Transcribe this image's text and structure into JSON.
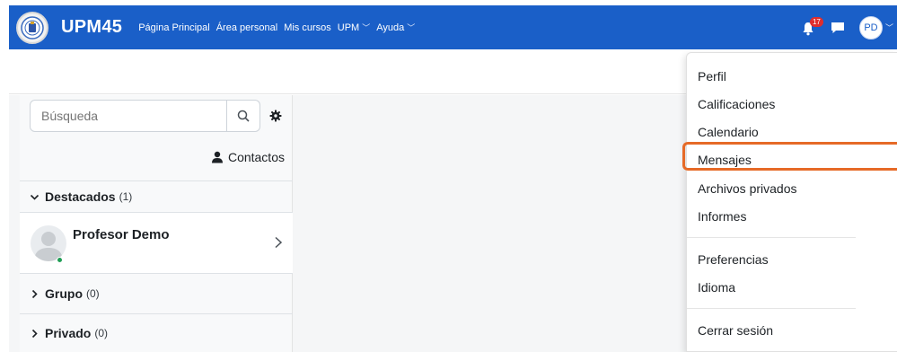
{
  "navbar": {
    "brand": "UPM45",
    "links": [
      {
        "label": "Página Principal",
        "has_dropdown": false
      },
      {
        "label": "Área personal",
        "has_dropdown": false
      },
      {
        "label": "Mis cursos",
        "has_dropdown": false
      },
      {
        "label": "UPM",
        "has_dropdown": true
      },
      {
        "label": "Ayuda",
        "has_dropdown": true
      }
    ],
    "notification_count": "17",
    "user_initials": "PD",
    "brand_color": "#1a5fc8"
  },
  "messaging": {
    "search_placeholder": "Búsqueda",
    "contacts_label": "Contactos",
    "sections": {
      "starred": {
        "label": "Destacados",
        "count": "(1)"
      },
      "group": {
        "label": "Grupo",
        "count": "(0)"
      },
      "private": {
        "label": "Privado",
        "count": "(0)"
      }
    },
    "starred_contact": {
      "name": "Profesor Demo",
      "status": "online"
    }
  },
  "user_menu": {
    "items": [
      {
        "label": "Perfil"
      },
      {
        "label": "Calificaciones"
      },
      {
        "label": "Calendario"
      },
      {
        "label": "Mensajes",
        "highlighted": true
      },
      {
        "label": "Archivos privados"
      },
      {
        "label": "Informes"
      }
    ],
    "items_group2": [
      {
        "label": "Preferencias"
      },
      {
        "label": "Idioma"
      }
    ],
    "logout": {
      "label": "Cerrar sesión"
    },
    "highlight_color": "#e66a27"
  }
}
